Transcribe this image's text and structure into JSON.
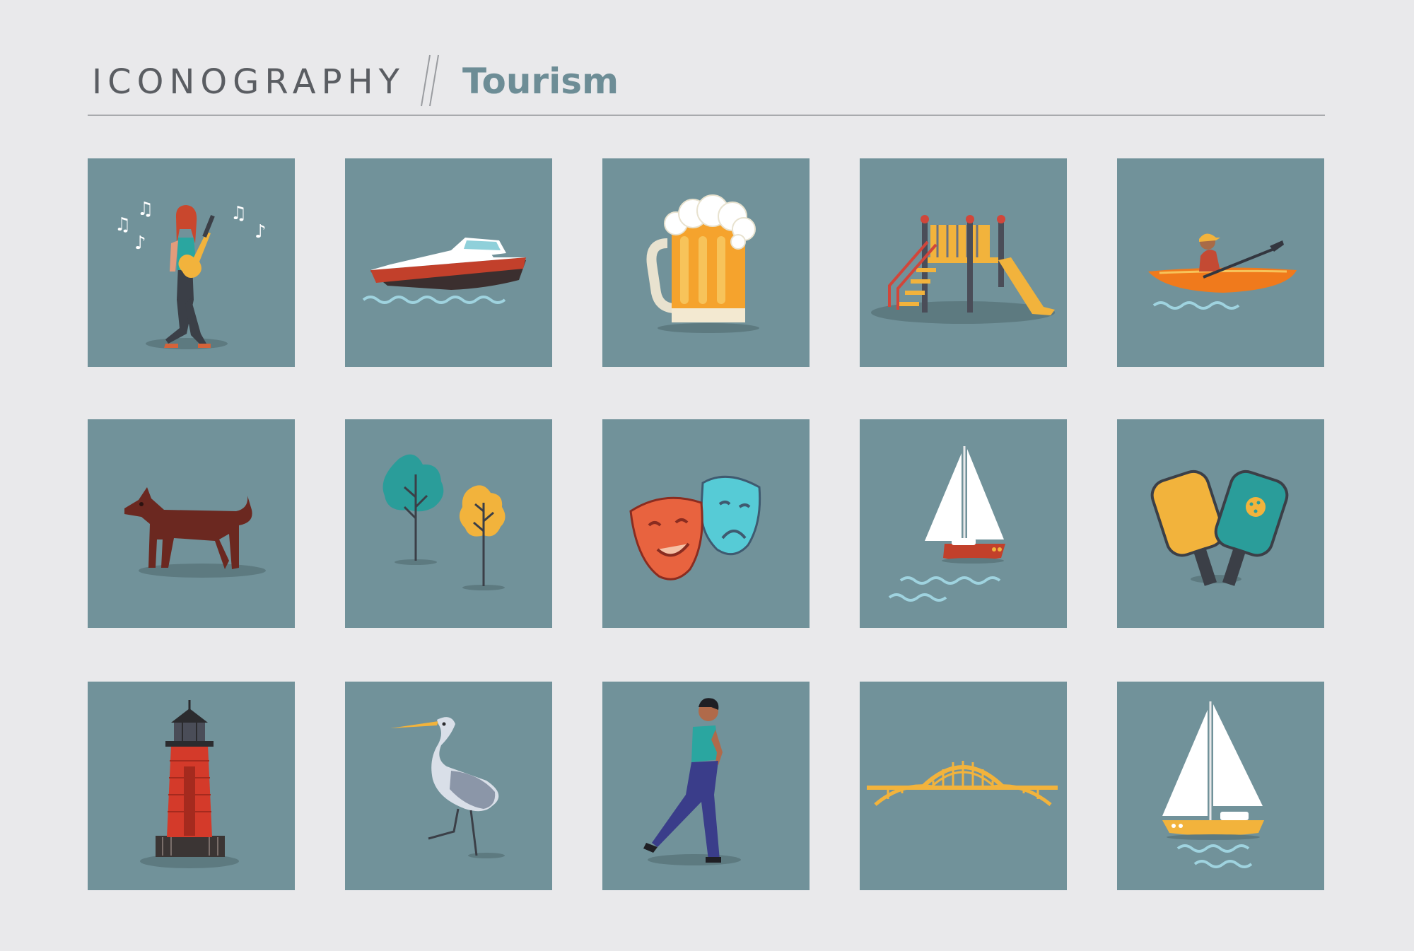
{
  "header": {
    "eyebrow": "ICONOGRAPHY",
    "title": "Tourism"
  },
  "colors": {
    "background": "#e9e9eb",
    "tile": "#71929a",
    "title_accent": "#6d8d96",
    "eyebrow_text": "#5a5d62"
  },
  "icons": [
    {
      "name": "guitarist-icon"
    },
    {
      "name": "speedboat-icon"
    },
    {
      "name": "beer-mug-icon"
    },
    {
      "name": "playground-slide-icon"
    },
    {
      "name": "kayaker-icon"
    },
    {
      "name": "dog-icon"
    },
    {
      "name": "trees-icon"
    },
    {
      "name": "theater-masks-icon"
    },
    {
      "name": "sailboat-icon"
    },
    {
      "name": "pickleball-paddles-icon"
    },
    {
      "name": "lighthouse-icon"
    },
    {
      "name": "heron-icon"
    },
    {
      "name": "walking-person-icon"
    },
    {
      "name": "arch-bridge-icon"
    },
    {
      "name": "yellow-sailboat-icon"
    }
  ]
}
